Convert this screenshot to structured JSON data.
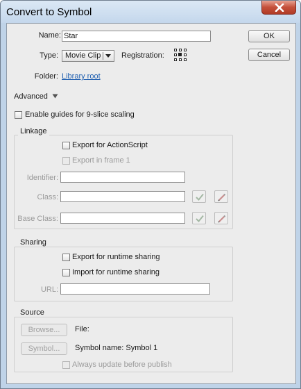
{
  "window": {
    "title": "Convert to Symbol"
  },
  "form": {
    "name_label": "Name:",
    "name_value": "Star",
    "type_label": "Type:",
    "type_value": "Movie Clip",
    "registration_label": "Registration:",
    "folder_label": "Folder:",
    "folder_value": "Library root",
    "advanced_label": "Advanced",
    "nine_slice_label": "Enable guides for 9-slice scaling"
  },
  "buttons": {
    "ok": "OK",
    "cancel": "Cancel"
  },
  "linkage": {
    "title": "Linkage",
    "export_actionscript": "Export for ActionScript",
    "export_frame1": "Export in frame 1",
    "identifier_label": "Identifier:",
    "identifier_value": "",
    "class_label": "Class:",
    "class_value": "",
    "base_class_label": "Base Class:",
    "base_class_value": ""
  },
  "sharing": {
    "title": "Sharing",
    "export_runtime": "Export for runtime sharing",
    "import_runtime": "Import for runtime sharing",
    "url_label": "URL:",
    "url_value": ""
  },
  "source": {
    "title": "Source",
    "browse_label": "Browse...",
    "file_label": "File:",
    "symbol_label": "Symbol...",
    "symbol_name": "Symbol name: Symbol 1",
    "always_update": "Always update before publish"
  },
  "colors": {
    "link": "#1f5fb0",
    "title_bar": "#c4d7ec",
    "close_button": "#c4503a"
  },
  "icons": {
    "close": "close-icon",
    "dropdown": "chevron-down-icon",
    "advanced": "triangle-down-icon",
    "validate": "checkmark-icon",
    "edit": "pencil-icon",
    "registration": "registration-grid-icon"
  }
}
